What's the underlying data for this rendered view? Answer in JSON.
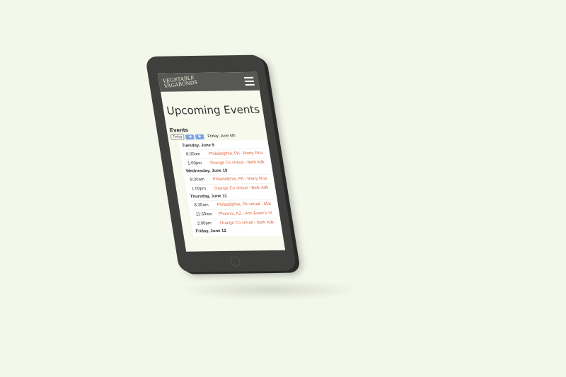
{
  "header": {
    "logo_text": "Vegetable Vagabonds",
    "menu_icon": "hamburger-icon"
  },
  "page_title": "Upcoming Events",
  "calendar": {
    "title": "Events",
    "today_label": "Today",
    "prev_icon": "◀",
    "next_icon": "▶",
    "current_date": "Friday, June 5th",
    "days": [
      {
        "label": "Tuesday, June 9",
        "events": [
          {
            "time": "8:30am",
            "title": "Philadelphia, PA - Marty Roa"
          },
          {
            "time": "1:00pm",
            "title": "Orange Co virtual - Beth Adk"
          }
        ]
      },
      {
        "label": "Wednesday, June 10",
        "events": [
          {
            "time": "8:30am",
            "title": "Philadelphia, PA - Marty Roa"
          },
          {
            "time": "1:00pm",
            "title": "Orange Co virtual - Beth Adk"
          }
        ]
      },
      {
        "label": "Thursday, June 11",
        "events": [
          {
            "time": "8:30am",
            "title": "Philadelphia, PA virtual - Mar"
          },
          {
            "time": "11:30am",
            "title": "Phoenix, AZ - Ann Ewen's Vi"
          },
          {
            "time": "2:00pm",
            "title": "Orange Co virtual - Beth Adk"
          }
        ]
      },
      {
        "label": "Friday, June 12",
        "events": []
      }
    ]
  }
}
